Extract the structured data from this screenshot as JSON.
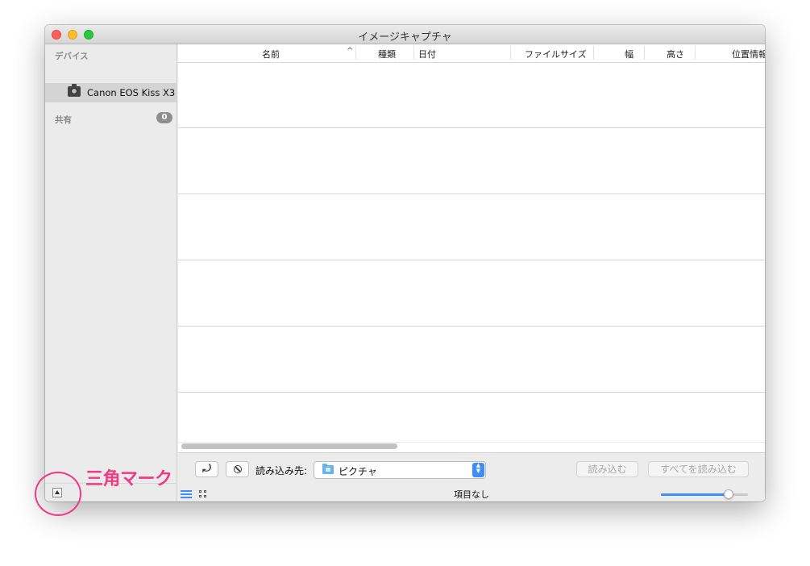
{
  "window": {
    "title": "イメージキャプチャ"
  },
  "sidebar": {
    "devices_header": "デバイス",
    "device": {
      "name": "Canon EOS Kiss X3",
      "icon": "camera-icon"
    },
    "shared_header": "共有",
    "shared_count": "0"
  },
  "table": {
    "columns": [
      "名前",
      "種類",
      "日付",
      "ファイルサイズ",
      "幅",
      "高さ",
      "位置情報"
    ],
    "sort_indicator": "^"
  },
  "toolbar": {
    "rotate_label": "⤾",
    "import_to_label": "読み込み先:",
    "destination": "ピクチャ",
    "import_button": "読み込む",
    "import_all_button": "すべてを読み込む",
    "item_count": "項目なし",
    "zoom_level": 0.78
  },
  "annotation": {
    "label": "三角マーク",
    "color": "#f03a83"
  },
  "colors": {
    "accent": "#3d8ef5",
    "close": "#fc5f57",
    "minimize": "#fdbc2e",
    "maximize": "#28c840"
  }
}
